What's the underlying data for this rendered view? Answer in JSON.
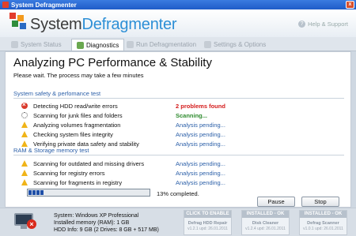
{
  "window": {
    "title": "System Defragmenter",
    "close_label": "x"
  },
  "header": {
    "brand_part1": "System",
    "brand_part2": "Defragmenter",
    "help_label": "Help & Support",
    "help_icon": "?"
  },
  "tabs": [
    {
      "label": "System Status",
      "active": false
    },
    {
      "label": "Diagnostics",
      "active": true
    },
    {
      "label": "Run Defragmentation",
      "active": false
    },
    {
      "label": "Settings & Options",
      "active": false
    }
  ],
  "main": {
    "title": "Analyzing PC Performance & Stability",
    "subtitle": "Please wait. The process may take a few minutes",
    "sections": [
      {
        "title": "System safety & perfomance test",
        "rows": [
          {
            "icon": "error-icon",
            "label": "Detecting HDD read/write errors",
            "status": "2 problems found",
            "status_color": "#d41b1b"
          },
          {
            "icon": "spinner-icon",
            "label": "Scanning for junk files and folders",
            "status": "Scanning...",
            "status_color": "#2e8b2e"
          },
          {
            "icon": "warning-icon",
            "label": "Analyzing volumes fragmentation",
            "status": "Analysis pending..."
          },
          {
            "icon": "warning-icon",
            "label": "Checking system files integrity",
            "status": "Analysis pending..."
          },
          {
            "icon": "warning-icon",
            "label": "Verifying private data safety and stability",
            "status": "Analysis pending..."
          }
        ]
      },
      {
        "title": "RAM & Storage memory test",
        "rows": [
          {
            "icon": "warning-icon",
            "label": "Scanning for outdated and missing drivers",
            "status": "Analysis pending..."
          },
          {
            "icon": "warning-icon",
            "label": "Scanning for registry errors",
            "status": "Analysis pending..."
          },
          {
            "icon": "warning-icon",
            "label": "Scanning for fragments in registry",
            "status": "Analysis pending..."
          }
        ]
      }
    ],
    "progress_fraction": 0.13,
    "progress_text": "13% completed.",
    "pause_label": "Pause",
    "stop_label": "Stop"
  },
  "footer": {
    "system": "System: Windows XP Professional",
    "memory": "Installed memory (RAM): 1 GB",
    "hdd": "HDD Info: 9 GB (2 Drives: 8 GB + 517 MB)",
    "badge": "×",
    "cards": [
      {
        "top": "CLICK TO ENABLE",
        "name": "Defrag HDD Repair",
        "meta": "v1.2.1 upd: 26.01.2011"
      },
      {
        "top": "INSTALLED - OK",
        "name": "Disk Cleaner",
        "meta": "v1.2.4 upd: 26.01.2011"
      },
      {
        "top": "INSTALLED - OK",
        "name": "Defrag Scanner",
        "meta": "v1.0.1 upd: 26.01.2011"
      }
    ]
  },
  "colors": {
    "accent": "#2d8fd6",
    "link_blue": "#2b5fa8",
    "error_red": "#d41b1b",
    "scan_green": "#2e8b2e",
    "titlebar": "#2a6fd8"
  }
}
